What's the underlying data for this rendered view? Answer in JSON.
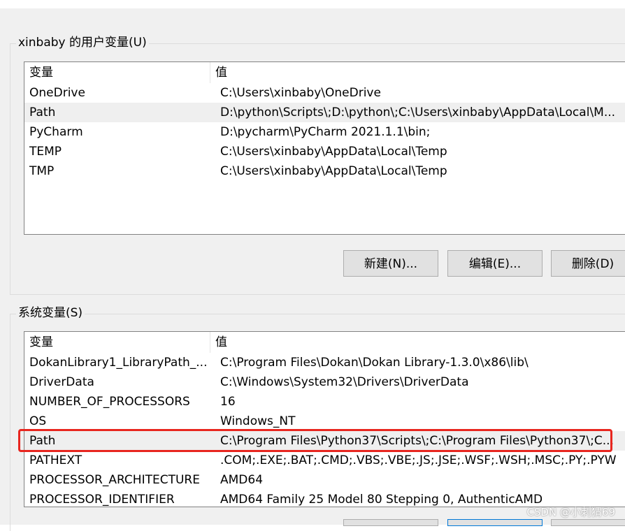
{
  "user_vars": {
    "title": "xinbaby 的用户变量(U)",
    "columns": {
      "name": "变量",
      "value": "值"
    },
    "rows": [
      {
        "name": "OneDrive",
        "value": "C:\\Users\\xinbaby\\OneDrive"
      },
      {
        "name": "Path",
        "value": "D:\\python\\Scripts\\;D:\\python\\;C:\\Users\\xinbaby\\AppData\\Local\\M..."
      },
      {
        "name": "PyCharm",
        "value": "D:\\pycharm\\PyCharm 2021.1.1\\bin;"
      },
      {
        "name": "TEMP",
        "value": "C:\\Users\\xinbaby\\AppData\\Local\\Temp"
      },
      {
        "name": "TMP",
        "value": "C:\\Users\\xinbaby\\AppData\\Local\\Temp"
      }
    ],
    "buttons": {
      "new": "新建(N)...",
      "edit": "编辑(E)...",
      "delete": "删除(D)"
    }
  },
  "system_vars": {
    "title": "系统变量(S)",
    "columns": {
      "name": "变量",
      "value": "值"
    },
    "rows": [
      {
        "name": "DokanLibrary1_LibraryPath_...",
        "value": "C:\\Program Files\\Dokan\\Dokan Library-1.3.0\\x86\\lib\\"
      },
      {
        "name": "DriverData",
        "value": "C:\\Windows\\System32\\Drivers\\DriverData"
      },
      {
        "name": "NUMBER_OF_PROCESSORS",
        "value": "16"
      },
      {
        "name": "OS",
        "value": "Windows_NT"
      },
      {
        "name": "Path",
        "value": "C:\\Program Files\\Python37\\Scripts\\;C:\\Program Files\\Python37\\;C..."
      },
      {
        "name": "PATHEXT",
        "value": ".COM;.EXE;.BAT;.CMD;.VBS;.VBE;.JS;.JSE;.WSF;.WSH;.MSC;.PY;.PYW"
      },
      {
        "name": "PROCESSOR_ARCHITECTURE",
        "value": "AMD64"
      },
      {
        "name": "PROCESSOR_IDENTIFIER",
        "value": "AMD64 Family 25 Model 80 Stepping 0, AuthenticAMD"
      }
    ]
  },
  "watermark": "CSDN @小刺猬69",
  "colors": {
    "highlight_border": "#e8261f",
    "selected_row": "#efefef"
  }
}
